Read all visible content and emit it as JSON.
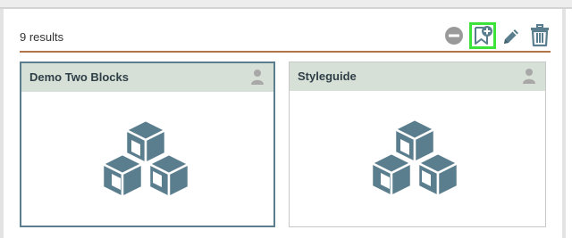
{
  "results": {
    "count_label": "9 results"
  },
  "toolbar": {
    "actions": [
      {
        "name": "remove",
        "icon": "minus-circle-icon"
      },
      {
        "name": "add-bookmark",
        "icon": "bookmark-plus-icon",
        "highlighted": true
      },
      {
        "name": "edit",
        "icon": "pencil-icon"
      },
      {
        "name": "delete",
        "icon": "trash-icon"
      }
    ]
  },
  "cards": [
    {
      "title": "Demo Two Blocks",
      "owner_icon": "user-icon",
      "thumbnail_icon": "cubes-icon",
      "selected": true
    },
    {
      "title": "Styleguide",
      "owner_icon": "user-icon",
      "thumbnail_icon": "cubes-icon",
      "selected": false
    }
  ],
  "colors": {
    "icon": "#5a7e8e",
    "accent_rule": "#b5734a",
    "highlight": "#3be33b",
    "card_header": "#d7e0d7"
  }
}
